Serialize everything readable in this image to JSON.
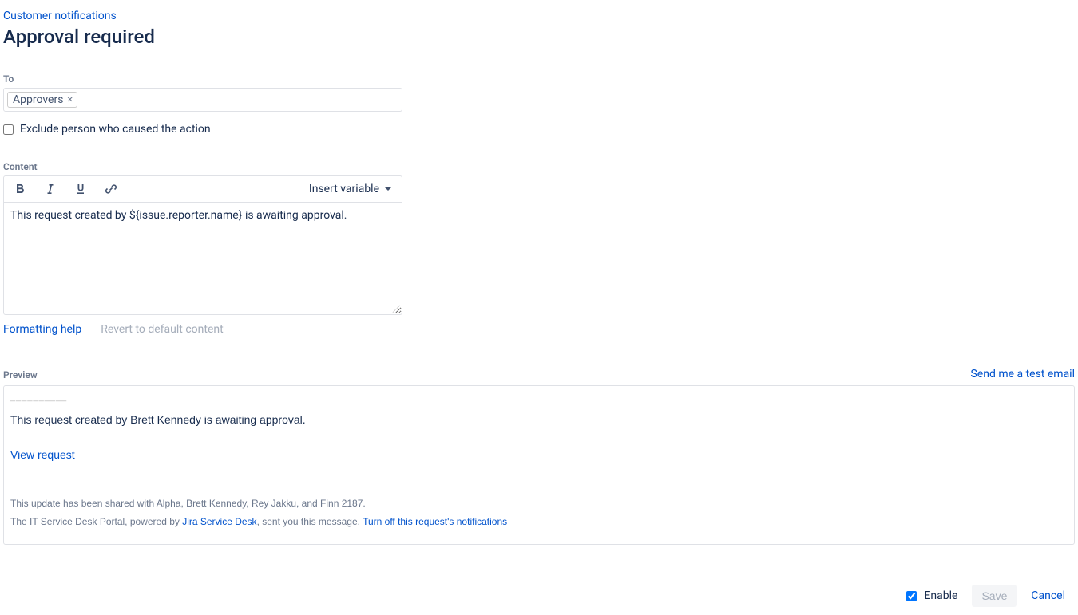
{
  "breadcrumb": "Customer notifications",
  "title": "Approval required",
  "to": {
    "label": "To",
    "chip": "Approvers",
    "exclude_label": "Exclude person who caused the action",
    "exclude_checked": false
  },
  "content": {
    "label": "Content",
    "insert_variable": "Insert variable",
    "body": "This request created by ${issue.reporter.name} is awaiting approval.",
    "formatting_help": "Formatting help",
    "revert": "Revert to default content"
  },
  "preview": {
    "label": "Preview",
    "send_test": "Send me a test email",
    "divider": "__________",
    "body_text": "This request created by Brett Kennedy is awaiting approval.",
    "view_request": "View request",
    "shared_text": "This update has been shared with Alpha, Brett Kennedy, Rey Jakku, and Finn 2187.",
    "portal_prefix": "The IT Service Desk Portal, powered by ",
    "jira_link": "Jira Service Desk",
    "portal_suffix": ", sent you this message. ",
    "turn_off": "Turn off this request's notifications"
  },
  "footer": {
    "enable_label": "Enable",
    "enable_checked": true,
    "save": "Save",
    "cancel": "Cancel"
  }
}
